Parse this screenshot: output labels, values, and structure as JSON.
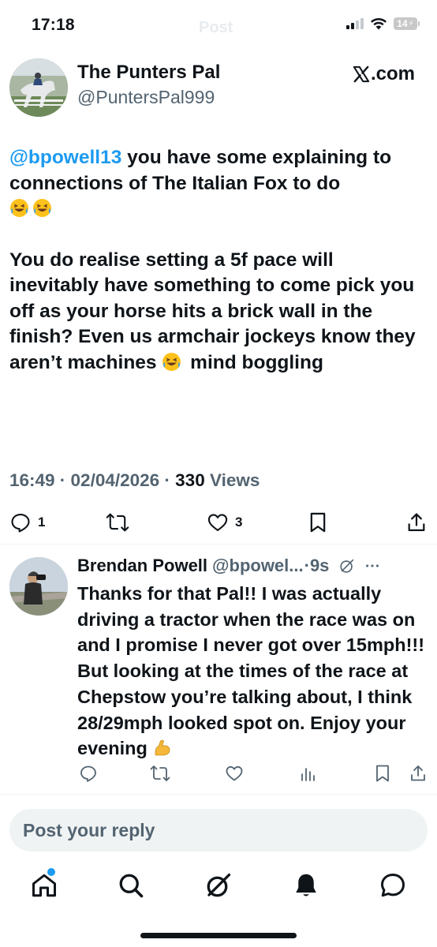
{
  "status_bar": {
    "time": "17:18",
    "ghost_title": "Post",
    "battery": "14"
  },
  "tweet": {
    "author_name": "The Punters Pal",
    "author_handle": "@PuntersPal999",
    "brand": ".com",
    "mention": "@bpowell13",
    "line1_rest": " you have some explaining to connections of The Italian Fox to do",
    "para2": "You do realise setting a 5f pace will inevitably have something to come pick you off as your horse hits a brick wall in the finish? Even us armchair jockeys know they aren’t machines",
    "para2_tail": " mind boggling",
    "time": "16:49",
    "date": "02/04/2026",
    "views_count": "330",
    "views_label": "Views",
    "reply_count": "1",
    "like_count": "3",
    "sep": " · "
  },
  "reply": {
    "name": "Brendan Powell",
    "handle": "@bpowel...",
    "time": "·9s",
    "text": "Thanks for that Pal!! I was actually driving a tractor when the race was on and I promise I never got over 15mph!!! But looking at the times of the race at Chepstow you’re talking about, I think 28/29mph looked spot on. Enjoy your evening"
  },
  "composer": {
    "placeholder": "Post your reply"
  },
  "colors": {
    "accent": "#1d9bf0",
    "muted": "#536471",
    "text": "#0f1419",
    "composer_bg": "#eff3f4"
  },
  "icons": {
    "tabs": [
      "home-icon",
      "search-icon",
      "grok-icon",
      "bell-icon",
      "messages-icon"
    ],
    "tweet_actions": [
      "reply-icon",
      "repost-icon",
      "like-icon",
      "bookmark-icon",
      "share-icon"
    ],
    "reply_actions": [
      "reply-icon",
      "repost-icon",
      "like-icon",
      "views-icon",
      "bookmark-icon",
      "share-icon"
    ]
  }
}
